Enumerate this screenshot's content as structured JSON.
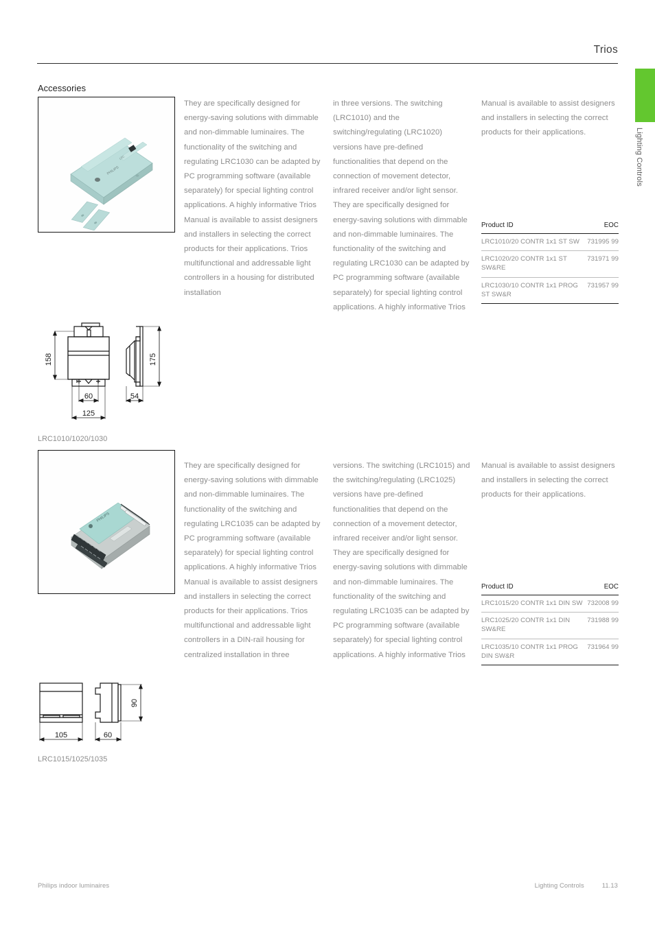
{
  "page": {
    "header_title": "Trios",
    "side_tab_label": "Lighting Controls",
    "accent_green": "#63c72f",
    "section_heading": "Accessories"
  },
  "footer": {
    "left": "Philips indoor luminaires",
    "section": "Lighting Controls",
    "page_number": "11.13"
  },
  "sections": [
    {
      "photo_alt": "Trios LRC1010/1020/1030 surface-mount light controller",
      "columns": [
        "They are specifically designed for energy-saving solutions with dimmable and non-dimmable luminaires. The functionality of the switching and regulating LRC1030 can be adapted by PC programming software (available separately) for special lighting control applications. A highly informative Trios Manual is available to assist designers and installers in selecting the correct products for their applications. Trios multifunctional and addressable light controllers in a housing for distributed installation",
        "in three versions. The switching (LRC1010) and the switching/regulating (LRC1020) versions have pre-defined functionalities that depend on the connection of movement detector, infrared receiver and/or light sensor. They are specifically designed for energy-saving solutions with dimmable and non-dimmable luminaires. The functionality of the switching and regulating LRC1030 can be adapted by PC programming software (available separately) for special lighting control applications. A highly informative Trios",
        "Manual is available to assist designers and installers in selecting the correct products for their applications."
      ],
      "table": {
        "headers": [
          "Product ID",
          "EOC"
        ],
        "rows": [
          {
            "product_id": "LRC1010/20 CONTR 1x1 ST SW",
            "eoc": "731995 99"
          },
          {
            "product_id": "LRC1020/20 CONTR 1x1 ST SW&RE",
            "eoc": "731971 99"
          },
          {
            "product_id": "LRC1030/10 CONTR 1x1 PROG ST SW&R",
            "eoc": "731957 99"
          }
        ]
      },
      "drawing": {
        "caption": "LRC1010/1020/1030",
        "dimensions": {
          "height_front": "158",
          "height_side": "175",
          "mount_spacing": "60",
          "depth": "54",
          "width": "125"
        }
      }
    },
    {
      "photo_alt": "Trios LRC1015/1025/1035 DIN-rail light controller",
      "columns": [
        "They are specifically designed for energy-saving solutions with dimmable and non-dimmable luminaires. The functionality of the switching and regulating LRC1035 can be adapted by PC programming software (available separately) for special lighting control applications. A highly informative Trios Manual is available to assist designers and installers in selecting the correct products for their applications. Trios multifunctional and addressable light controllers in a DIN-rail housing for centralized installation in three",
        "versions. The switching (LRC1015) and the switching/regulating (LRC1025) versions have pre-defined functionalities that depend on the connection of a movement detector, infrared receiver and/or light sensor. They are specifically designed for energy-saving solutions with dimmable and non-dimmable luminaires. The functionality of the switching and regulating LRC1035 can be adapted by PC programming software (available separately) for special lighting control applications. A highly informative Trios",
        "Manual is available to assist designers and installers in selecting the correct products for their applications."
      ],
      "table": {
        "headers": [
          "Product ID",
          "EOC"
        ],
        "rows": [
          {
            "product_id": "LRC1015/20 CONTR 1x1 DIN SW",
            "eoc": "732008 99"
          },
          {
            "product_id": "LRC1025/20 CONTR 1x1 DIN SW&RE",
            "eoc": "731988 99"
          },
          {
            "product_id": "LRC1035/10 CONTR 1x1 PROG DIN SW&R",
            "eoc": "731964 99"
          }
        ]
      },
      "drawing": {
        "caption": "LRC1015/1025/1035",
        "dimensions": {
          "width": "105",
          "depth": "60",
          "height": "90"
        }
      }
    }
  ]
}
